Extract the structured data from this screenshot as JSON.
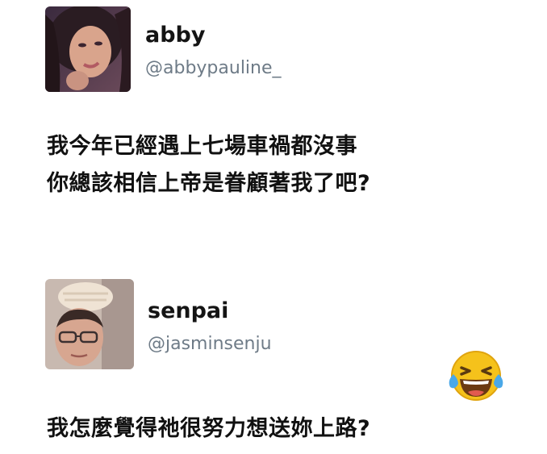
{
  "tweets": [
    {
      "display_name": "abby",
      "handle": "@abbypauline_",
      "body_lines": [
        "我今年已經遇上七場車禍都沒事",
        "你總該相信上帝是眷顧著我了吧?"
      ]
    },
    {
      "display_name": "senpai",
      "handle": "@jasminsenju",
      "body_lines": [
        "我怎麼覺得祂很努力想送妳上路?"
      ],
      "reaction_icon": "laughing-tears-emoji"
    }
  ],
  "colors": {
    "name": "#141414",
    "handle": "#6e7b87",
    "body": "#111111",
    "emoji_face": "#f5c21b",
    "emoji_tears": "#4aa8e8"
  }
}
